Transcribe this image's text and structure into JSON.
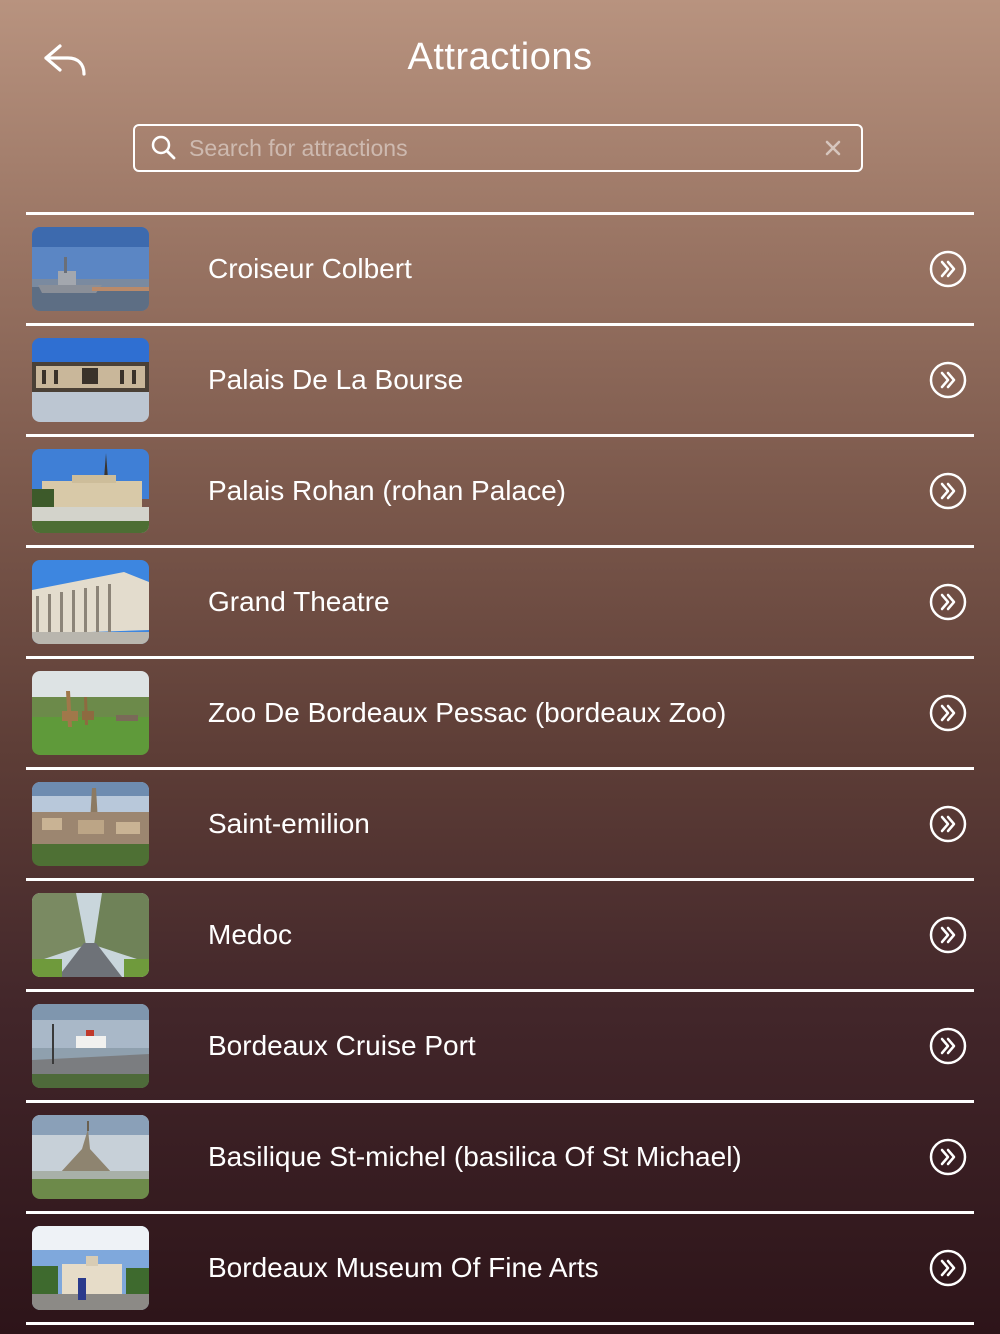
{
  "header": {
    "title": "Attractions",
    "back_icon": "back-arrow-icon"
  },
  "search": {
    "placeholder": "Search for attractions",
    "value": "",
    "icon": "search-icon",
    "clear_icon": "clear-icon"
  },
  "attractions": [
    {
      "label": "Croiseur Colbert",
      "thumbnail": "warship-harbor-photo"
    },
    {
      "label": "Palais De La Bourse",
      "thumbnail": "palace-square-photo"
    },
    {
      "label": "Palais Rohan (rohan Palace)",
      "thumbnail": "palace-garden-photo"
    },
    {
      "label": "Grand Theatre",
      "thumbnail": "colonnade-theatre-photo"
    },
    {
      "label": "Zoo De Bordeaux Pessac (bordeaux Zoo)",
      "thumbnail": "giraffes-field-photo"
    },
    {
      "label": "Saint-emilion",
      "thumbnail": "village-church-photo"
    },
    {
      "label": "Medoc",
      "thumbnail": "tree-lined-road-photo"
    },
    {
      "label": "Bordeaux Cruise Port",
      "thumbnail": "cruise-ship-quay-photo"
    },
    {
      "label": "Basilique St-michel (basilica Of St Michael)",
      "thumbnail": "abbey-island-photo"
    },
    {
      "label": "Bordeaux Museum Of Fine Arts",
      "thumbnail": "museum-building-photo"
    }
  ],
  "row_action_icon": "chevron-right-circle-icon",
  "colors": {
    "background_top": "#b8937f",
    "background_bottom": "#2d1419",
    "foreground": "#ffffff"
  }
}
